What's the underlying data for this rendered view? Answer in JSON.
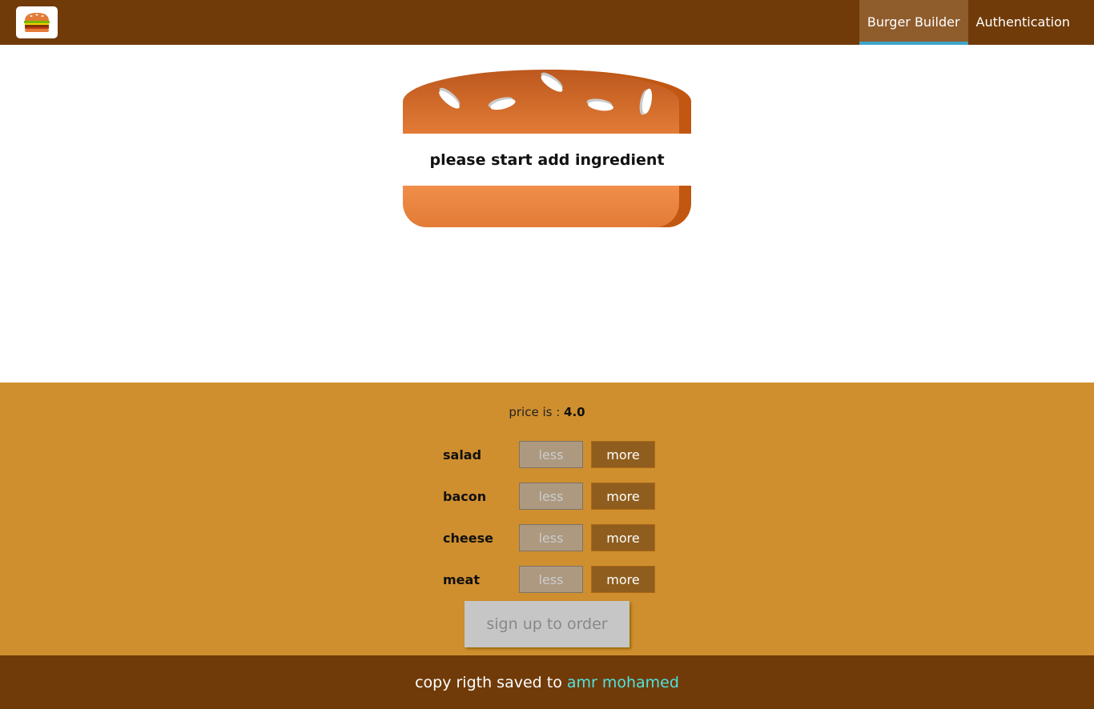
{
  "toolbar": {
    "logo_icon": "burger-logo-icon",
    "nav": [
      {
        "label": "Burger Builder",
        "active": true
      },
      {
        "label": "Authentication",
        "active": false
      }
    ]
  },
  "burger": {
    "message": "please start add ingredient"
  },
  "controls": {
    "price_label": "price is :",
    "price_value": "4.0",
    "ingredients": [
      {
        "label": "salad",
        "less": "less",
        "more": "more"
      },
      {
        "label": "bacon",
        "less": "less",
        "more": "more"
      },
      {
        "label": "cheese",
        "less": "less",
        "more": "more"
      },
      {
        "label": "meat",
        "less": "less",
        "more": "more"
      }
    ],
    "order_label": "sign up to order"
  },
  "footer": {
    "text": "copy rigth saved to",
    "author": "amr mohamed"
  },
  "colors": {
    "toolbar_bg": "#703b09",
    "controls_bg": "#cf8f2e",
    "more_button": "#8f5e1e",
    "author_link": "#4fe3df"
  }
}
